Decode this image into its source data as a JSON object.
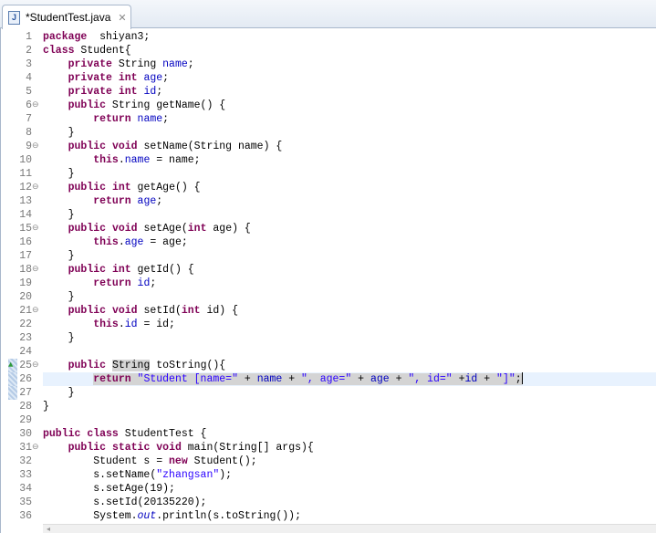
{
  "tab": {
    "title": "*StudentTest.java",
    "icon": "java-file-icon",
    "close": "✕"
  },
  "current_line": 26,
  "fold_lines": [
    6,
    9,
    12,
    15,
    18,
    21,
    25,
    31
  ],
  "override_line": 25,
  "diff_lines": [
    25,
    26,
    27
  ],
  "lines": [
    [
      [
        "kw",
        "package"
      ],
      [
        "",
        "  shiyan3;"
      ]
    ],
    [
      [
        "kw",
        "class"
      ],
      [
        "",
        " Student{"
      ]
    ],
    [
      [
        "",
        "    "
      ],
      [
        "kw",
        "private"
      ],
      [
        "",
        " String "
      ],
      [
        "fld",
        "name"
      ],
      [
        "",
        ";"
      ]
    ],
    [
      [
        "",
        "    "
      ],
      [
        "kw",
        "private"
      ],
      [
        "",
        " "
      ],
      [
        "kw",
        "int"
      ],
      [
        "",
        " "
      ],
      [
        "fld",
        "age"
      ],
      [
        "",
        ";"
      ]
    ],
    [
      [
        "",
        "    "
      ],
      [
        "kw",
        "private"
      ],
      [
        "",
        " "
      ],
      [
        "kw",
        "int"
      ],
      [
        "",
        " "
      ],
      [
        "fld",
        "id"
      ],
      [
        "",
        ";"
      ]
    ],
    [
      [
        "",
        "    "
      ],
      [
        "kw",
        "public"
      ],
      [
        "",
        " String getName() {"
      ]
    ],
    [
      [
        "",
        "        "
      ],
      [
        "kw",
        "return"
      ],
      [
        "",
        " "
      ],
      [
        "fld",
        "name"
      ],
      [
        "",
        ";"
      ]
    ],
    [
      [
        "",
        "    }"
      ]
    ],
    [
      [
        "",
        "    "
      ],
      [
        "kw",
        "public"
      ],
      [
        "",
        " "
      ],
      [
        "kw",
        "void"
      ],
      [
        "",
        " setName(String name) {"
      ]
    ],
    [
      [
        "",
        "        "
      ],
      [
        "kw",
        "this"
      ],
      [
        "",
        "."
      ],
      [
        "fld",
        "name"
      ],
      [
        "",
        " = name;"
      ]
    ],
    [
      [
        "",
        "    }"
      ]
    ],
    [
      [
        "",
        "    "
      ],
      [
        "kw",
        "public"
      ],
      [
        "",
        " "
      ],
      [
        "kw",
        "int"
      ],
      [
        "",
        " getAge() {"
      ]
    ],
    [
      [
        "",
        "        "
      ],
      [
        "kw",
        "return"
      ],
      [
        "",
        " "
      ],
      [
        "fld",
        "age"
      ],
      [
        "",
        ";"
      ]
    ],
    [
      [
        "",
        "    }"
      ]
    ],
    [
      [
        "",
        "    "
      ],
      [
        "kw",
        "public"
      ],
      [
        "",
        " "
      ],
      [
        "kw",
        "void"
      ],
      [
        "",
        " setAge("
      ],
      [
        "kw",
        "int"
      ],
      [
        "",
        " age) {"
      ]
    ],
    [
      [
        "",
        "        "
      ],
      [
        "kw",
        "this"
      ],
      [
        "",
        "."
      ],
      [
        "fld",
        "age"
      ],
      [
        "",
        " = age;"
      ]
    ],
    [
      [
        "",
        "    }"
      ]
    ],
    [
      [
        "",
        "    "
      ],
      [
        "kw",
        "public"
      ],
      [
        "",
        " "
      ],
      [
        "kw",
        "int"
      ],
      [
        "",
        " getId() {"
      ]
    ],
    [
      [
        "",
        "        "
      ],
      [
        "kw",
        "return"
      ],
      [
        "",
        " "
      ],
      [
        "fld",
        "id"
      ],
      [
        "",
        ";"
      ]
    ],
    [
      [
        "",
        "    }"
      ]
    ],
    [
      [
        "",
        "    "
      ],
      [
        "kw",
        "public"
      ],
      [
        "",
        " "
      ],
      [
        "kw",
        "void"
      ],
      [
        "",
        " setId("
      ],
      [
        "kw",
        "int"
      ],
      [
        "",
        " id) {"
      ]
    ],
    [
      [
        "",
        "        "
      ],
      [
        "kw",
        "this"
      ],
      [
        "",
        "."
      ],
      [
        "fld",
        "id"
      ],
      [
        "",
        " = id;"
      ]
    ],
    [
      [
        "",
        "    }"
      ]
    ],
    [],
    [
      [
        "",
        "    "
      ],
      [
        "kw",
        "public"
      ],
      [
        "",
        " "
      ],
      [
        "hl",
        "String"
      ],
      [
        "",
        " toString(){"
      ]
    ],
    [
      [
        "",
        "        "
      ],
      [
        "kw hl",
        "return"
      ],
      [
        "hl",
        " "
      ],
      [
        "str hl",
        "\"Student [name=\""
      ],
      [
        "hl",
        " + "
      ],
      [
        "fld hl",
        "name"
      ],
      [
        "hl",
        " + "
      ],
      [
        "str hl",
        "\", age=\""
      ],
      [
        "hl",
        " + "
      ],
      [
        "fld hl",
        "age"
      ],
      [
        "hl",
        " + "
      ],
      [
        "str hl",
        "\", id=\""
      ],
      [
        "hl",
        " +"
      ],
      [
        "fld hl",
        "id"
      ],
      [
        "hl",
        " + "
      ],
      [
        "str hl",
        "\"]\""
      ],
      [
        "hl",
        ";"
      ]
    ],
    [
      [
        "",
        "    }"
      ]
    ],
    [
      [
        "",
        "}"
      ]
    ],
    [],
    [
      [
        "kw",
        "public"
      ],
      [
        "",
        " "
      ],
      [
        "kw",
        "class"
      ],
      [
        "",
        " StudentTest {"
      ]
    ],
    [
      [
        "",
        "    "
      ],
      [
        "kw",
        "public"
      ],
      [
        "",
        " "
      ],
      [
        "kw",
        "static"
      ],
      [
        "",
        " "
      ],
      [
        "kw",
        "void"
      ],
      [
        "",
        " main(String[] args){"
      ]
    ],
    [
      [
        "",
        "        Student s = "
      ],
      [
        "kw",
        "new"
      ],
      [
        "",
        " Student();"
      ]
    ],
    [
      [
        "",
        "        s.setName("
      ],
      [
        "str",
        "\"zhangsan\""
      ],
      [
        "",
        ");"
      ]
    ],
    [
      [
        "",
        "        s.setAge(19);"
      ]
    ],
    [
      [
        "",
        "        s.setId(20135220);"
      ]
    ],
    [
      [
        "",
        "        System."
      ],
      [
        "st",
        "out"
      ],
      [
        "",
        ".println(s.toString());"
      ]
    ]
  ]
}
